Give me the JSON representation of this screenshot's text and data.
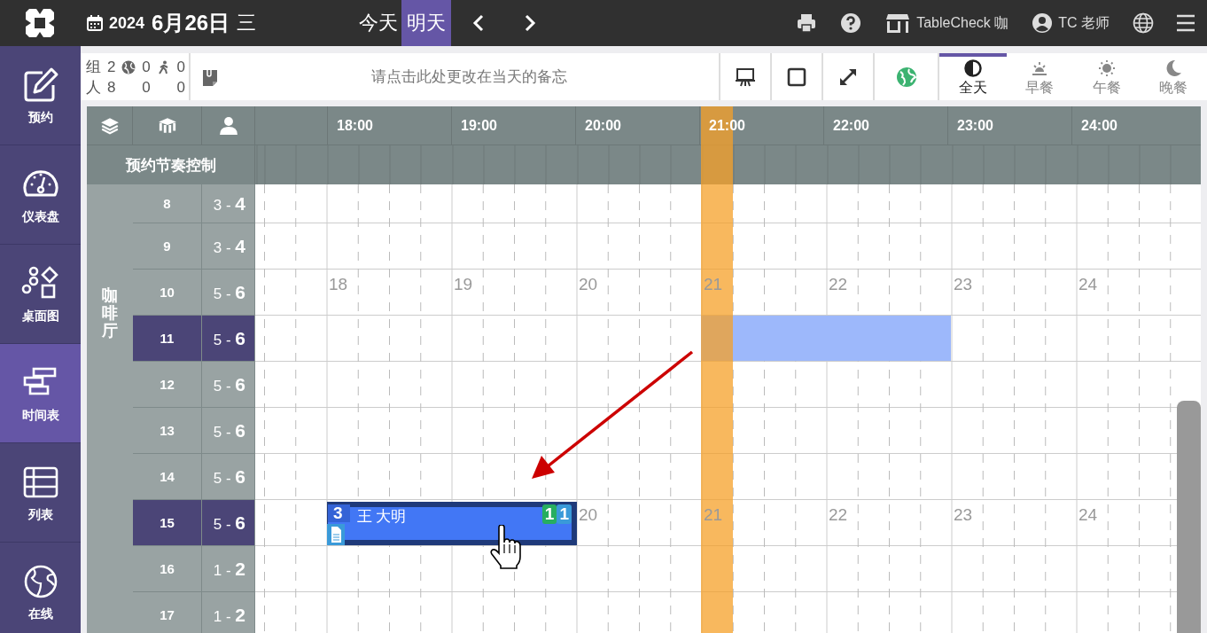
{
  "top_bar": {
    "year": "2024",
    "date": "6月26日",
    "weekday": "三",
    "day_tabs": [
      {
        "label": "今天",
        "selected": false
      },
      {
        "label": "明天",
        "selected": true
      }
    ],
    "store": "TableCheck 咖",
    "user": "TC 老师"
  },
  "sidebar": {
    "items": [
      {
        "label": "预约",
        "kind": "edit",
        "selected": false
      },
      {
        "label": "仪表盘",
        "kind": "gauge",
        "selected": false
      },
      {
        "label": "桌面图",
        "kind": "shapes",
        "selected": false
      },
      {
        "label": "时间表",
        "kind": "timeline",
        "selected": true
      },
      {
        "label": "列表",
        "kind": "table",
        "selected": false
      },
      {
        "label": "在线",
        "kind": "globe",
        "selected": false
      }
    ]
  },
  "stats": [
    {
      "label": "组",
      "values": [
        "2",
        "0",
        "0"
      ]
    },
    {
      "label": "人",
      "values": [
        "8",
        "0",
        "0"
      ]
    }
  ],
  "memo": {
    "placeholder": "请点击此处更改在当天的备忘"
  },
  "service_tabs": [
    {
      "label": "全天",
      "kind": "all",
      "selected": true
    },
    {
      "label": "早餐",
      "kind": "breakfast",
      "selected": false
    },
    {
      "label": "午餐",
      "kind": "lunch",
      "selected": false
    },
    {
      "label": "晚餐",
      "kind": "dinner",
      "selected": false
    }
  ],
  "timeline": {
    "hours": [
      "18:00",
      "19:00",
      "20:00",
      "21:00",
      "22:00",
      "23:00",
      "24:00"
    ],
    "pacing_label": "预约节奏控制",
    "area": "咖啡厅",
    "rows": [
      {
        "table": "8",
        "capacity": "3 - **4**",
        "selected": false
      },
      {
        "table": "9",
        "capacity": "3 - **4**",
        "selected": false
      },
      {
        "table": "10",
        "capacity": "5 - **6**",
        "selected": false,
        "hour_marks": [
          "18",
          "19",
          "20",
          "21",
          "22",
          "23",
          "24"
        ]
      },
      {
        "table": "11",
        "capacity": "5 - **6**",
        "selected": true,
        "drop_target": true
      },
      {
        "table": "12",
        "capacity": "5 - **6**",
        "selected": false
      },
      {
        "table": "13",
        "capacity": "5 - **6**",
        "selected": false
      },
      {
        "table": "14",
        "capacity": "5 - **6**",
        "selected": false
      },
      {
        "table": "15",
        "capacity": "5 - **6**",
        "selected": true,
        "hour_marks": [
          "20",
          "21",
          "22",
          "23",
          "24"
        ],
        "reservation": {
          "guests": "3",
          "name": "王 大明",
          "has_memo": true,
          "badges": [
            {
              "text": "1",
              "color": "#27ae60"
            },
            {
              "text": "1",
              "color": "#3a9ad9"
            }
          ]
        }
      },
      {
        "table": "16",
        "capacity": "1 - **2**",
        "selected": false
      },
      {
        "table": "17",
        "capacity": "1 - **2**",
        "selected": false
      }
    ]
  }
}
